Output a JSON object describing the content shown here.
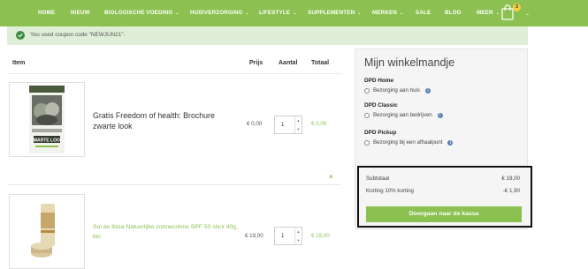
{
  "nav": {
    "items": [
      {
        "label": "HOME",
        "chevron": false
      },
      {
        "label": "NIEUW",
        "chevron": false
      },
      {
        "label": "BIOLOGISCHE VOEDING",
        "chevron": true
      },
      {
        "label": "HUIDVERZORGING",
        "chevron": true
      },
      {
        "label": "LIFESTYLE",
        "chevron": true
      },
      {
        "label": "SUPPLEMENTEN",
        "chevron": true
      },
      {
        "label": "MERKEN",
        "chevron": true
      },
      {
        "label": "SALE",
        "chevron": false
      },
      {
        "label": "BLOG",
        "chevron": false
      },
      {
        "label": "MEER",
        "chevron": true
      }
    ],
    "chevron_glyph": "⌄",
    "cart_count": "3",
    "icon": "shopping-bag-icon"
  },
  "notice": {
    "text": "You used coupon code \"NEWJUN21\"."
  },
  "table": {
    "headers": {
      "item": "Item",
      "price": "Prijs",
      "qty": "Aantal",
      "total": "Totaal"
    },
    "rows": [
      {
        "name": "Gratis Freedom of health: Brochure zwarte look",
        "price": "€ 0,00",
        "qty": "1",
        "total": "€ 0,00",
        "thumb_caption": "ZWARTE LOOK"
      },
      {
        "name": "Sol de Ibiza Natuurlijke zonnecrème SPF 50 stick 40g, bio",
        "price": "€ 19,00",
        "qty": "1",
        "total": "€ 19,00"
      }
    ],
    "remove_glyph": "×"
  },
  "sidebar": {
    "title": "Mijn winkelmandje",
    "shipping": [
      {
        "title": "DPD Home",
        "option": "Bezorging aan huis"
      },
      {
        "title": "DPD Classic",
        "option": "Bezorging aan bedrijven"
      },
      {
        "title": "DPD Pickup",
        "option": "Bezorging bij een afhaalpunt"
      }
    ],
    "info_glyph": "i",
    "summary": {
      "subtotal_label": "Subtotaal",
      "subtotal_value": "€ 19,00",
      "discount_label": "Korting 10% korting",
      "discount_value": "-€ 1,90",
      "checkout_label": "Doorgaan naar de kassa"
    }
  },
  "colors": {
    "brand_green": "#8cc152",
    "notice_bg": "#dfeed7",
    "check_green": "#3d8c40"
  }
}
